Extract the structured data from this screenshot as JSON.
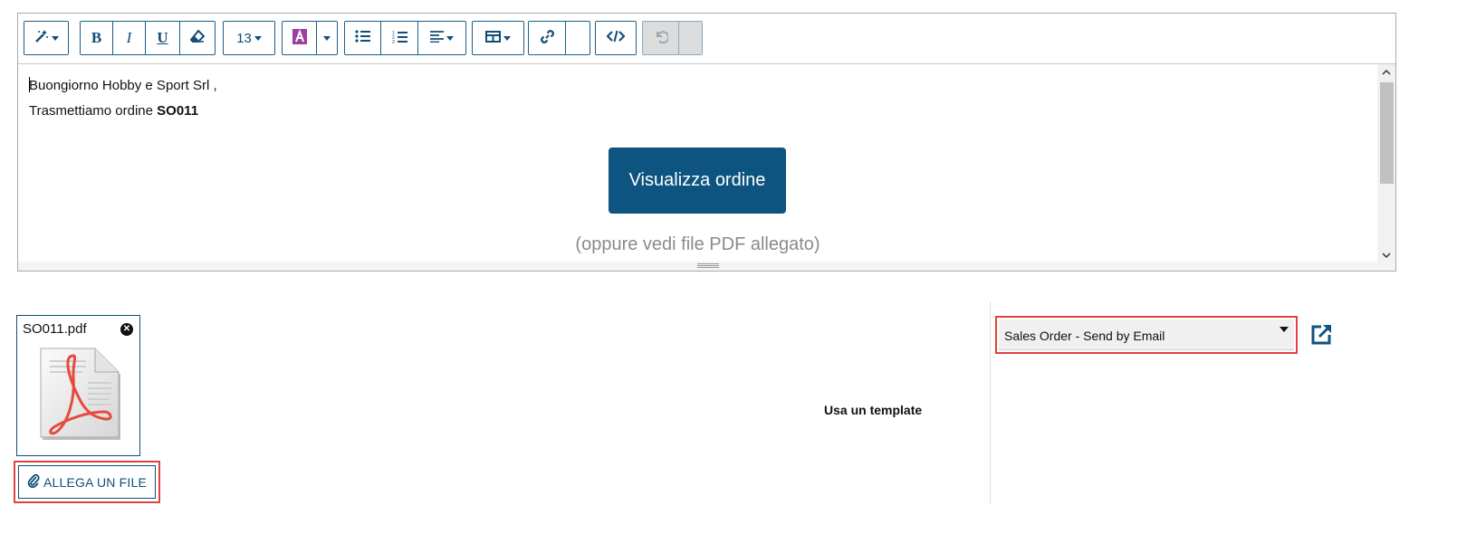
{
  "toolbar": {
    "font_size": "13"
  },
  "editor": {
    "greeting": "Buongiorno Hobby e Sport Srl ,",
    "order_prefix": "Trasmettiamo ordine",
    "order_number": "SO011",
    "view_button_label": "Visualizza ordine",
    "pdf_note": "(oppure vedi file PDF allegato)"
  },
  "attachment": {
    "file_name": "SO011.pdf",
    "attach_button_label": "ALLEGA UN FILE"
  },
  "template": {
    "label": "Usa un template",
    "selected": "Sales Order - Send by Email"
  },
  "colors": {
    "accent": "#0d5480",
    "highlight_border": "#e0433f"
  },
  "icons": [
    "magic-wand-icon",
    "bold-icon",
    "italic-icon",
    "underline-icon",
    "eraser-icon",
    "text-color-icon",
    "unordered-list-icon",
    "ordered-list-icon",
    "align-icon",
    "table-icon",
    "link-icon",
    "code-view-icon",
    "undo-icon",
    "remove-icon",
    "pdf-file-icon",
    "paperclip-icon",
    "external-link-icon"
  ]
}
